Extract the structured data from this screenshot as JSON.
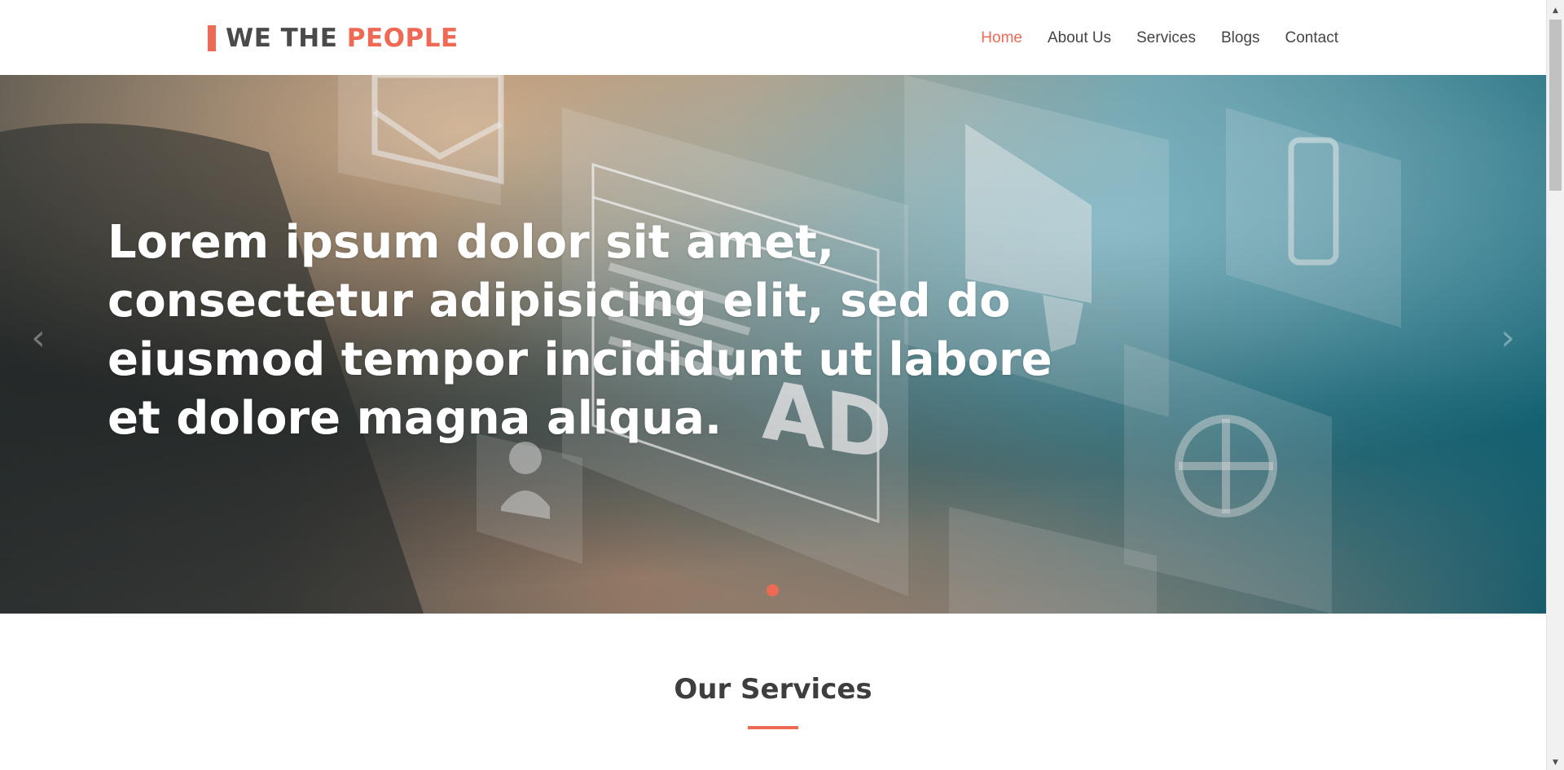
{
  "header": {
    "logo": {
      "text_main": "WE THE ",
      "text_accent": "PEOPLE"
    },
    "nav": [
      {
        "label": "Home",
        "active": true
      },
      {
        "label": "About Us",
        "active": false
      },
      {
        "label": "Services",
        "active": false
      },
      {
        "label": "Blogs",
        "active": false
      },
      {
        "label": "Contact",
        "active": false
      }
    ]
  },
  "hero": {
    "headline": "Lorem ipsum dolor sit amet, consectetur adipisicing elit, sed do eiusmod tempor incididunt ut labore et dolore magna aliqua.",
    "prev_icon": "chevron-left-icon",
    "next_icon": "chevron-right-icon",
    "prev_glyph": "‹",
    "next_glyph": "›",
    "image_badge_text": "AD"
  },
  "services": {
    "title": "Our Services"
  },
  "scrollbar": {
    "up_glyph": "▲",
    "down_glyph": "▼"
  },
  "colors": {
    "accent": "#ee6a55",
    "text_dark": "#444444",
    "heading": "#3e3e3e"
  }
}
